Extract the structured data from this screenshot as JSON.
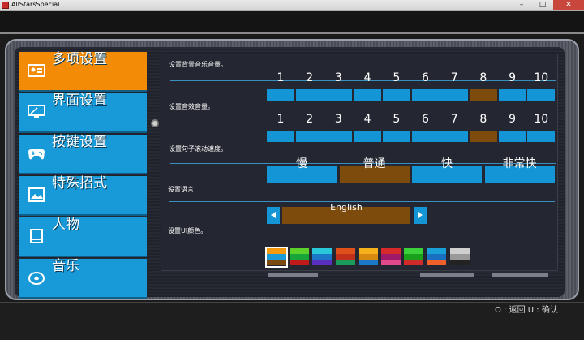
{
  "window": {
    "title": "AllStarsSpecial",
    "minimize": "–",
    "maximize": "□",
    "close": "✕"
  },
  "sidebar": {
    "items": [
      {
        "label": "多项设置",
        "icon": "id-card-icon",
        "active": true
      },
      {
        "label": "界面设置",
        "icon": "monitor-icon",
        "active": false
      },
      {
        "label": "按键设置",
        "icon": "gamepad-icon",
        "active": false
      },
      {
        "label": "特殊招式",
        "icon": "picture-icon",
        "active": false
      },
      {
        "label": "人物",
        "icon": "book-icon",
        "active": false
      },
      {
        "label": "音乐",
        "icon": "disc-icon",
        "active": false
      }
    ]
  },
  "settings": {
    "bgm_label": "设置背景音乐音量。",
    "bgm_levels": [
      "1",
      "2",
      "3",
      "4",
      "5",
      "6",
      "7",
      "8",
      "9",
      "10"
    ],
    "bgm_selected": 8,
    "se_label": "设置音效音量。",
    "se_levels": [
      "1",
      "2",
      "3",
      "4",
      "5",
      "6",
      "7",
      "8",
      "9",
      "10"
    ],
    "se_selected": 8,
    "scroll_label": "设置句子滚动速度。",
    "scroll_speeds": [
      "慢",
      "普通",
      "快",
      "非常快"
    ],
    "scroll_selected": 2,
    "lang_label": "设置语言",
    "lang_value": "English",
    "ui_color_label": "设置UI颜色。",
    "ui_colors": [
      [
        "#f59a0d",
        "#1a9bd8",
        "#7a4a10"
      ],
      [
        "#5bd12a",
        "#18a63b",
        "#c01a1a"
      ],
      [
        "#27c9d9",
        "#1a77c8",
        "#5a2fc0"
      ],
      [
        "#e0501a",
        "#c0301a",
        "#1a9b5a"
      ],
      [
        "#f5b01a",
        "#d88a10",
        "#1a7ac8"
      ],
      [
        "#d82a2a",
        "#a01a6a",
        "#e04a8a"
      ],
      [
        "#3ad13a",
        "#1aa01a",
        "#d02a2a"
      ],
      [
        "#1aa0d8",
        "#1a70c0",
        "#f0602a"
      ],
      [
        "#cfcfcf",
        "#9a9a9a",
        "#222222"
      ]
    ],
    "ui_color_selected": 0
  },
  "footer": {
    "hint": "O : 返回  U : 确认"
  },
  "colors": {
    "accent": "#f38b07",
    "item_blue": "#199ad8",
    "box_blue": "#1495d6",
    "box_selected": "#7d4b0b"
  }
}
